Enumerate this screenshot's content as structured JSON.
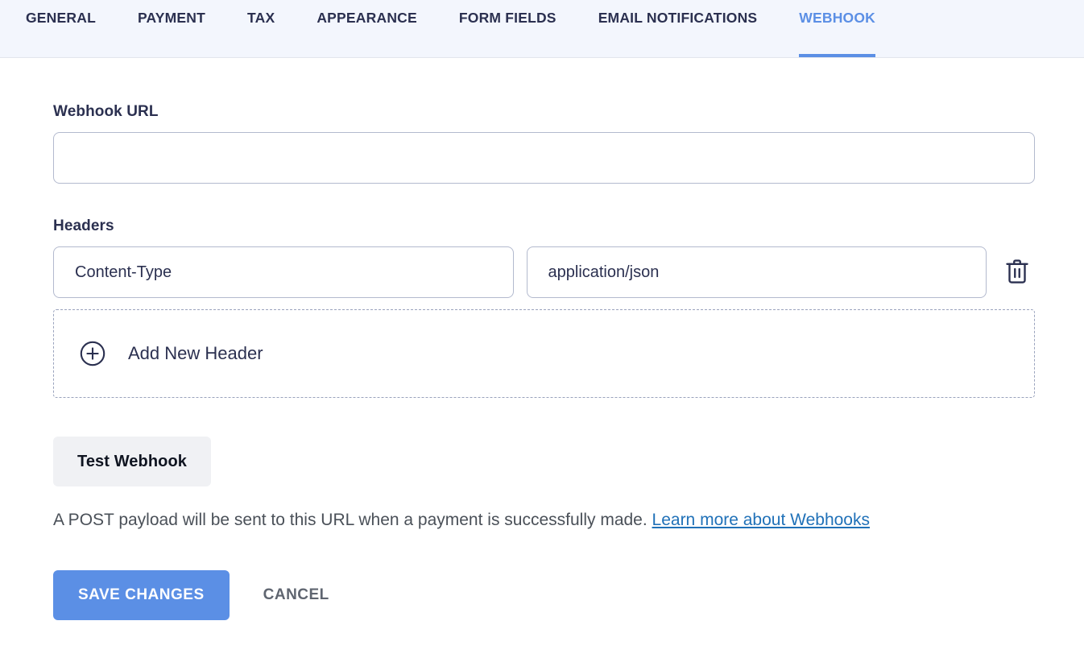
{
  "tabs": [
    {
      "label": "GENERAL",
      "name": "tab-general",
      "active": false
    },
    {
      "label": "PAYMENT",
      "name": "tab-payment",
      "active": false
    },
    {
      "label": "TAX",
      "name": "tab-tax",
      "active": false
    },
    {
      "label": "APPEARANCE",
      "name": "tab-appearance",
      "active": false
    },
    {
      "label": "FORM FIELDS",
      "name": "tab-form-fields",
      "active": false
    },
    {
      "label": "EMAIL NOTIFICATIONS",
      "name": "tab-email-notifications",
      "active": false
    },
    {
      "label": "WEBHOOK",
      "name": "tab-webhook",
      "active": true
    }
  ],
  "webhook_url": {
    "label": "Webhook URL",
    "value": "",
    "placeholder": ""
  },
  "headers": {
    "label": "Headers",
    "rows": [
      {
        "key": "Content-Type",
        "key_placeholder": "",
        "value": "application/json",
        "value_placeholder": "",
        "delete_icon": "trash-icon"
      }
    ],
    "add_label": "Add New Header",
    "add_icon": "plus-circle-icon"
  },
  "test_button": {
    "label": "Test Webhook"
  },
  "description": {
    "text": "A POST payload will be sent to this URL when a payment is successfully made.",
    "link_text": "Learn more about Webhooks"
  },
  "actions": {
    "save_label": "SAVE CHANGES",
    "cancel_label": "CANCEL"
  },
  "colors": {
    "accent": "#5b8fe5",
    "tabbar_bg": "#f3f6fd",
    "text": "#2b3050",
    "link": "#2071b8",
    "input_border": "#b3bace",
    "test_button_bg": "#f0f1f4"
  }
}
